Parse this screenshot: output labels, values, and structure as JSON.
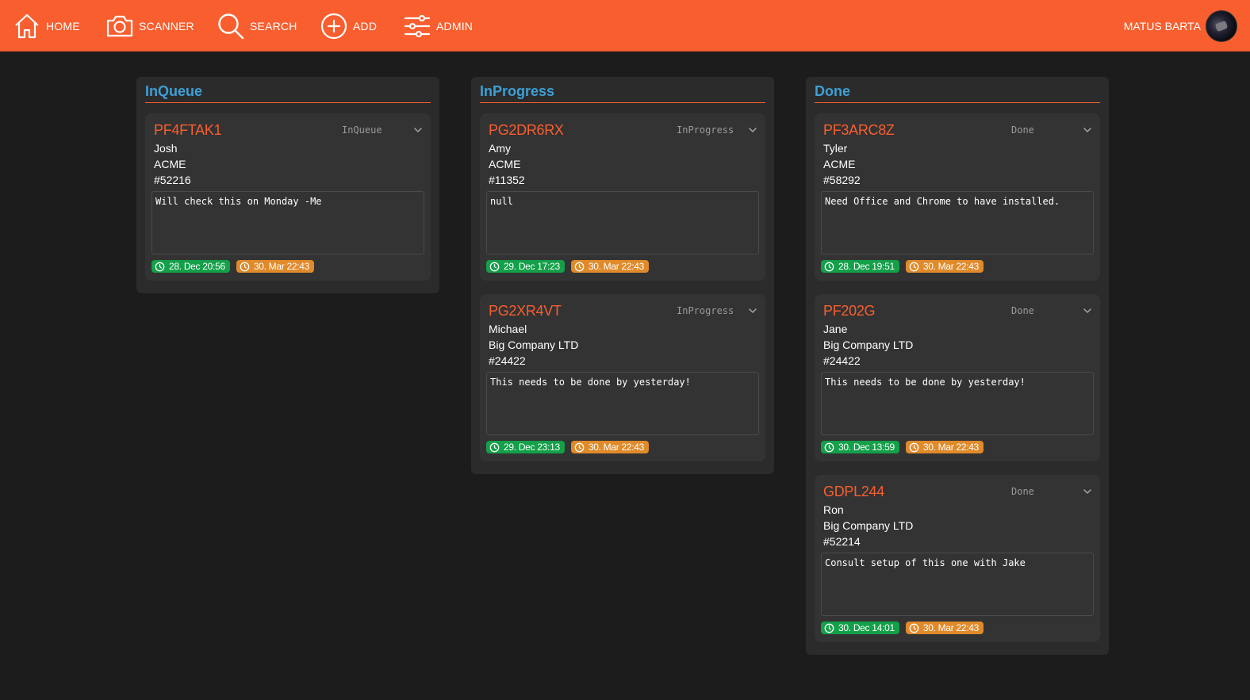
{
  "nav": {
    "home": "HOME",
    "scanner": "SCANNER",
    "search": "SEARCH",
    "add": "ADD",
    "admin": "ADMIN",
    "user_name": "MATUS BARTA"
  },
  "columns": [
    {
      "title": "InQueue",
      "cards": [
        {
          "id": "PF4FTAK1",
          "status": "InQueue",
          "name": "Josh",
          "company": "ACME",
          "number": "#52216",
          "note": "Will check this on Monday -Me",
          "created": "28. Dec 20:56",
          "due": "30. Mar 22:43"
        }
      ]
    },
    {
      "title": "InProgress",
      "cards": [
        {
          "id": "PG2DR6RX",
          "status": "InProgress",
          "name": "Amy",
          "company": "ACME",
          "number": "#11352",
          "note": "null",
          "created": "29. Dec 17:23",
          "due": "30. Mar 22:43"
        },
        {
          "id": "PG2XR4VT",
          "status": "InProgress",
          "name": "Michael",
          "company": "Big Company LTD",
          "number": "#24422",
          "note": "This needs to be done by yesterday!",
          "created": "29. Dec 23:13",
          "due": "30. Mar 22:43"
        }
      ]
    },
    {
      "title": "Done",
      "cards": [
        {
          "id": "PF3ARC8Z",
          "status": "Done",
          "name": "Tyler",
          "company": "ACME",
          "number": "#58292",
          "note": "Need Office and Chrome to have installed.",
          "created": "28. Dec 19:51",
          "due": "30. Mar 22:43"
        },
        {
          "id": "PF202G",
          "status": "Done",
          "name": "Jane",
          "company": "Big Company LTD",
          "number": "#24422",
          "note": "This needs to be done by yesterday!",
          "created": "30. Dec 13:59",
          "due": "30. Mar 22:43"
        },
        {
          "id": "GDPL244",
          "status": "Done",
          "name": "Ron",
          "company": "Big Company LTD",
          "number": "#52214",
          "note": "Consult setup of this one with Jake",
          "created": "30. Dec 14:01",
          "due": "30. Mar 22:43"
        }
      ]
    }
  ],
  "colors": {
    "brand": "#f95e2f",
    "column_title": "#3d9fd6",
    "created_badge": "#13a049",
    "due_badge": "#e08a2a"
  }
}
